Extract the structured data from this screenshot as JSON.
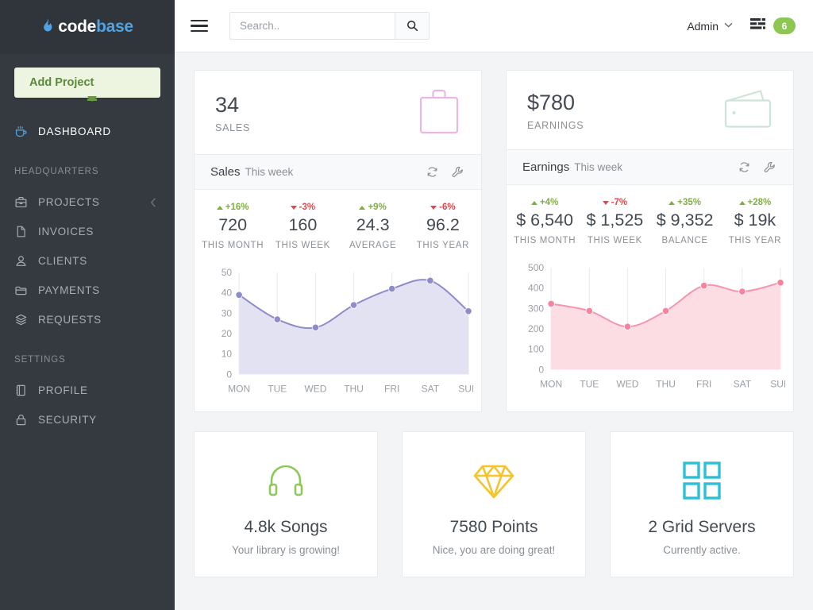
{
  "brand": {
    "part1": "code",
    "part2": "base",
    "flame_icon": "flame-icon"
  },
  "sidebar": {
    "add_project_label": "Add Project",
    "primary": [
      {
        "label": "DASHBOARD",
        "icon": "coffee-cup-icon",
        "active": true
      }
    ],
    "sections": [
      {
        "title": "HEADQUARTERS",
        "items": [
          {
            "label": "PROJECTS",
            "icon": "briefcase-icon",
            "chevron": true
          },
          {
            "label": "INVOICES",
            "icon": "file-icon",
            "chevron": false
          },
          {
            "label": "CLIENTS",
            "icon": "user-icon",
            "chevron": false
          },
          {
            "label": "PAYMENTS",
            "icon": "folder-icon",
            "chevron": false
          },
          {
            "label": "REQUESTS",
            "icon": "layers-icon",
            "chevron": false
          }
        ]
      },
      {
        "title": "SETTINGS",
        "items": [
          {
            "label": "PROFILE",
            "icon": "address-book-icon",
            "chevron": false
          },
          {
            "label": "SECURITY",
            "icon": "lock-icon",
            "chevron": false
          }
        ]
      }
    ]
  },
  "topbar": {
    "menu_toggle_icon": "hamburger-icon",
    "search": {
      "value": "",
      "placeholder": "Search..",
      "button_icon": "search-icon"
    },
    "admin_label": "Admin",
    "admin_caret_icon": "chevron-down-icon",
    "server_icon": "server-list-icon",
    "badge_count": "6",
    "badge_color": "#8dc653"
  },
  "sales_card": {
    "headline": "34",
    "headline_label": "SALES",
    "header_icon": "shopping-bag-icon",
    "header_icon_color": "#e8b7e2",
    "bar_title": "Sales",
    "bar_subtitle": "This week",
    "refresh_icon": "refresh-icon",
    "settings_icon": "wrench-icon",
    "metrics": [
      {
        "delta": "+16%",
        "direction": "up",
        "value": "720",
        "caption": "THIS MONTH"
      },
      {
        "delta": "-3%",
        "direction": "down",
        "value": "160",
        "caption": "THIS WEEK"
      },
      {
        "delta": "+9%",
        "direction": "up",
        "value": "24.3",
        "caption": "AVERAGE"
      },
      {
        "delta": "-6%",
        "direction": "down",
        "value": "96.2",
        "caption": "THIS YEAR"
      }
    ]
  },
  "earnings_card": {
    "headline": "$780",
    "headline_label": "EARNINGS",
    "header_icon": "wallet-icon",
    "header_icon_color": "#cfe3d8",
    "bar_title": "Earnings",
    "bar_subtitle": "This week",
    "refresh_icon": "refresh-icon",
    "settings_icon": "wrench-icon",
    "metrics": [
      {
        "delta": "+4%",
        "direction": "up",
        "value": "$ 6,540",
        "caption": "THIS MONTH"
      },
      {
        "delta": "-7%",
        "direction": "down",
        "value": "$ 1,525",
        "caption": "THIS WEEK"
      },
      {
        "delta": "+35%",
        "direction": "up",
        "value": "$ 9,352",
        "caption": "BALANCE"
      },
      {
        "delta": "+28%",
        "direction": "up",
        "value": "$ 19k",
        "caption": "THIS YEAR"
      }
    ]
  },
  "info_cards": [
    {
      "icon": "headphones-icon",
      "color": "#8ec75a",
      "title": "4.8k Songs",
      "subtitle": "Your library is growing!"
    },
    {
      "icon": "diamond-icon",
      "color": "#f5c32c",
      "title": "7580 Points",
      "subtitle": "Nice, you are doing great!"
    },
    {
      "icon": "grid-icon",
      "color": "#2cc0d8",
      "title": "2 Grid Servers",
      "subtitle": "Currently active."
    }
  ],
  "chart_data": [
    {
      "type": "area",
      "name": "sales-chart",
      "title": "Sales This week",
      "categories": [
        "MON",
        "TUE",
        "WED",
        "THU",
        "FRI",
        "SAT",
        "SUN"
      ],
      "values": [
        39,
        27,
        23,
        34,
        42,
        46,
        31
      ],
      "yticks": [
        0,
        10,
        20,
        30,
        40,
        50
      ],
      "ylim": [
        0,
        50
      ],
      "xlabel": "",
      "ylabel": "",
      "grid": true,
      "legend": "none",
      "line_color": "#8e8cc9",
      "fill_color": "#e3e2f2",
      "point_color": "#8e8cc9"
    },
    {
      "type": "area",
      "name": "earnings-chart",
      "title": "Earnings This week",
      "categories": [
        "MON",
        "TUE",
        "WED",
        "THU",
        "FRI",
        "SAT",
        "SUN"
      ],
      "values": [
        323,
        288,
        211,
        288,
        412,
        383,
        427
      ],
      "yticks": [
        0,
        100,
        200,
        300,
        400,
        500
      ],
      "ylim": [
        0,
        500
      ],
      "xlabel": "",
      "ylabel": "",
      "grid": true,
      "legend": "none",
      "line_color": "#f795ae",
      "fill_color": "#fcdde4",
      "point_color": "#f7839f"
    }
  ]
}
